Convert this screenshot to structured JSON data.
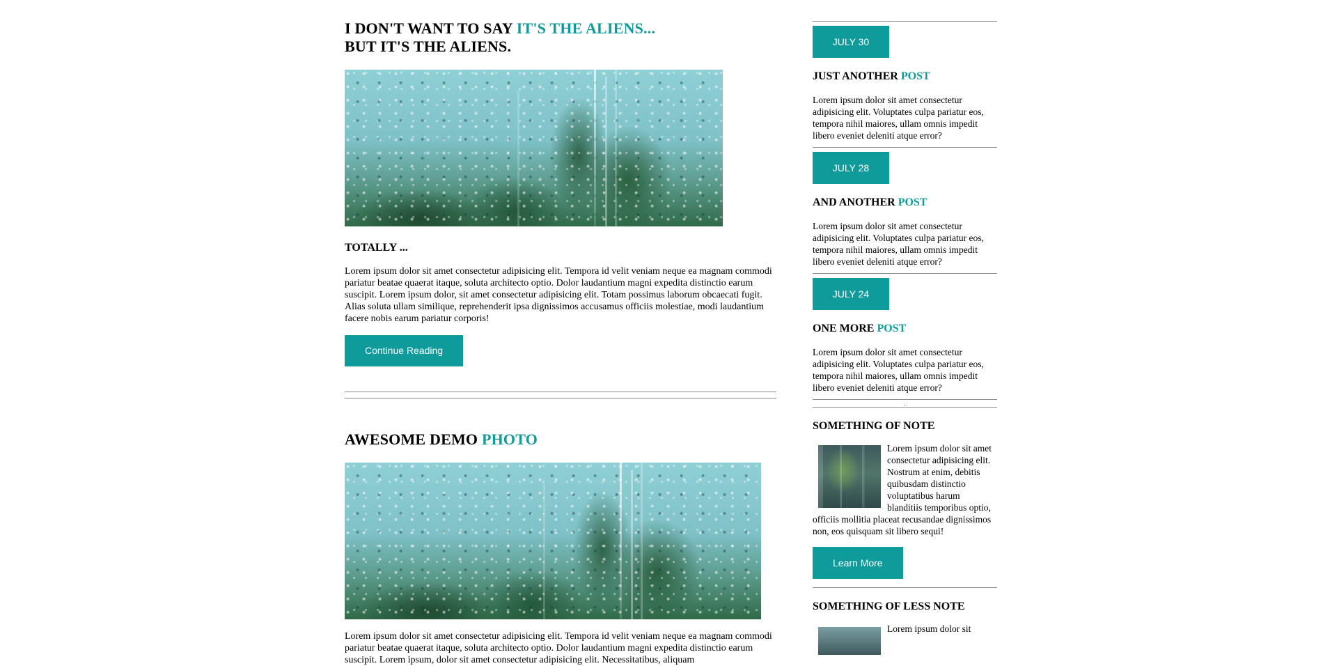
{
  "main": {
    "post1": {
      "title_line1_plain": "I DON'T WANT TO SAY ",
      "title_line1_accent": "IT'S THE ALIENS...",
      "title_line2": "BUT IT'S THE ALIENS.",
      "subtitle": "TOTALLY ...",
      "body": "Lorem ipsum dolor sit amet consectetur adipisicing elit. Tempora id velit veniam neque ea magnam commodi pariatur beatae quaerat itaque, soluta architecto optio. Dolor laudantium magni expedita distinctio earum suscipit. Lorem ipsum dolor, sit amet consectetur adipisicing elit. Totam possimus laborum obcaecati fugit. Alias soluta ullam similique, reprehenderit ipsa dignissimos accusamus officiis molestiae, modi laudantium facere nobis earum pariatur corporis!",
      "button": "Continue Reading"
    },
    "post2": {
      "title_plain": "AWESOME DEMO ",
      "title_accent": "PHOTO",
      "body": "Lorem ipsum dolor sit amet consectetur adipisicing elit. Tempora id velit veniam neque ea magnam commodi pariatur beatae quaerat itaque, soluta architecto optio. Dolor laudantium magni expedita distinctio earum suscipit. Lorem ipsum, dolor sit amet consectetur adipisicing elit. Necessitatibus, aliquam"
    }
  },
  "sidebar": {
    "posts": [
      {
        "date": "JULY 30",
        "title_plain": "JUST ANOTHER ",
        "title_accent": "POST",
        "text": "Lorem ipsum dolor sit amet consectetur adipisicing elit. Voluptates culpa pariatur eos, tempora nihil maiores, ullam omnis impedit libero eveniet deleniti atque error?"
      },
      {
        "date": "JULY 28",
        "title_plain": "AND ANOTHER ",
        "title_accent": "POST",
        "text": "Lorem ipsum dolor sit amet consectetur adipisicing elit. Voluptates culpa pariatur eos, tempora nihil maiores, ullam omnis impedit libero eveniet deleniti atque error?"
      },
      {
        "date": "JULY 24",
        "title_plain": "ONE MORE ",
        "title_accent": "POST",
        "text": "Lorem ipsum dolor sit amet consectetur adipisicing elit. Voluptates culpa pariatur eos, tempora nihil maiores, ullam omnis impedit libero eveniet deleniti atque error?"
      }
    ],
    "divider_mark": ".",
    "note1": {
      "title": "SOMETHING OF NOTE",
      "text": "Lorem ipsum dolor sit amet consectetur adipisicing elit. Nostrum at enim, debitis quibusdam distinctio voluptatibus harum blanditiis temporibus optio, officiis mollitia placeat recusandae dignissimos non, eos quisquam sit libero sequi!",
      "button": "Learn More"
    },
    "note2": {
      "title": "SOMETHING OF LESS NOTE",
      "text": "Lorem ipsum dolor sit"
    }
  },
  "colors": {
    "accent": "#0f9b9b",
    "rule": "#888888"
  }
}
